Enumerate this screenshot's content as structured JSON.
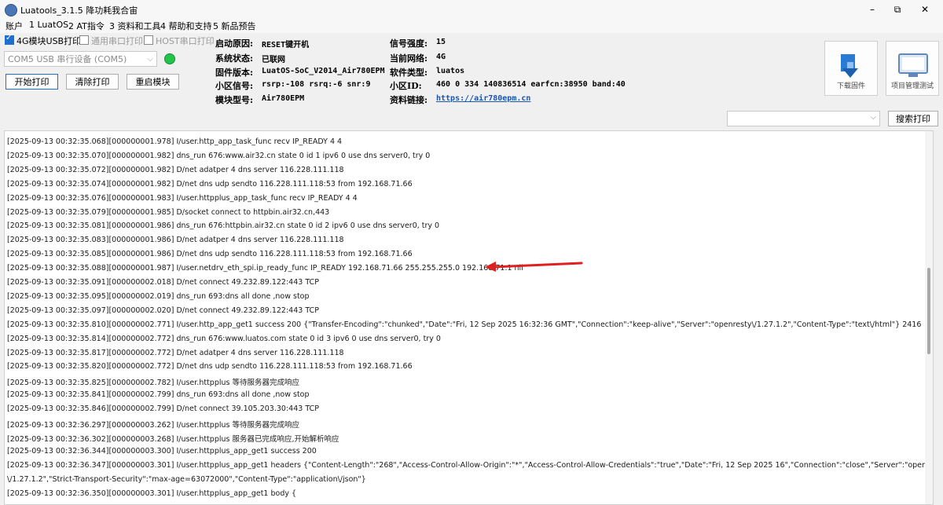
{
  "window": {
    "title": "Luatools_3.1.5 降功耗我合宙",
    "minimize": "–",
    "maximize": "⧉",
    "close": "✕"
  },
  "menu": [
    "账户",
    "1 LuatOS",
    "2 AT指令",
    "3 资料和工具",
    "4 帮助和支持",
    "5 新品预告"
  ],
  "options": {
    "usb_print": "4G模块USB打印",
    "serial_print": "通用串口打印",
    "host_print": "HOST串口打印"
  },
  "port": {
    "value": "COM5 USB 串行设备 (COM5)",
    "status_color": "#22c44a"
  },
  "buttons": {
    "start_print": "开始打印",
    "clear_print": "清除打印",
    "restart_module": "重启模块",
    "search_print": "搜索打印"
  },
  "info": {
    "boot_reason_label": "启动原因:",
    "boot_reason": "RESET键开机",
    "system_state_label": "系统状态:",
    "system_state": "已联网",
    "firmware_label": "固件版本:",
    "firmware": "LuatOS-SoC_V2014_Air780EPM",
    "cell_signal_label": "小区信号:",
    "cell_signal": "rsrp:-108 rsrq:-6 snr:9",
    "module_model_label": "模块型号:",
    "module_model": "Air780EPM",
    "signal_strength_label": "信号强度:",
    "signal_strength": "15",
    "network_label": "当前网络:",
    "network": "4G",
    "software_type_label": "软件类型:",
    "software_type": "luatos",
    "cell_id_label": "小区ID:",
    "cell_id": "460 0 334 140836514 earfcn:38950 band:40",
    "doc_link_label": "资料链接:",
    "doc_link": "https://air780epm.cn"
  },
  "tools": {
    "download_firmware": "下载固件",
    "project_management": "项目管理测试"
  },
  "log_lines": [
    "[2025-09-13 00:32:35.068][000000001.978] I/user.http_app_task_func recv IP_READY 4 4",
    "[2025-09-13 00:32:35.070][000000001.982] dns_run 676:www.air32.cn state 0 id 1 ipv6 0 use dns server0, try 0",
    "[2025-09-13 00:32:35.072][000000001.982] D/net adatper 4 dns server 116.228.111.118",
    "[2025-09-13 00:32:35.074][000000001.982] D/net dns udp sendto 116.228.111.118:53 from 192.168.71.66",
    "[2025-09-13 00:32:35.076][000000001.983] I/user.httpplus_app_task_func recv IP_READY 4 4",
    "[2025-09-13 00:32:35.079][000000001.985] D/socket connect to httpbin.air32.cn,443",
    "[2025-09-13 00:32:35.081][000000001.986] dns_run 676:httpbin.air32.cn state 0 id 2 ipv6 0 use dns server0, try 0",
    "[2025-09-13 00:32:35.083][000000001.986] D/net adatper 4 dns server 116.228.111.118",
    "[2025-09-13 00:32:35.085][000000001.986] D/net dns udp sendto 116.228.111.118:53 from 192.168.71.66",
    "[2025-09-13 00:32:35.088][000000001.987] I/user.netdrv_eth_spi.ip_ready_func IP_READY 192.168.71.66 255.255.255.0 192.168.71.1 nil",
    "[2025-09-13 00:32:35.091][000000002.018] D/net connect 49.232.89.122:443 TCP",
    "[2025-09-13 00:32:35.095][000000002.019] dns_run 693:dns all done ,now stop",
    "[2025-09-13 00:32:35.097][000000002.020] D/net connect 49.232.89.122:443 TCP",
    "[2025-09-13 00:32:35.810][000000002.771] I/user.http_app_get1 success 200 {\"Transfer-Encoding\":\"chunked\",\"Date\":\"Fri, 12 Sep 2025 16:32:36 GMT\",\"Connection\":\"keep-alive\",\"Server\":\"openresty\\/1.27.1.2\",\"Content-Type\":\"text\\/html\"} 2416",
    "[2025-09-13 00:32:35.814][000000002.772] dns_run 676:www.luatos.com state 0 id 3 ipv6 0 use dns server0, try 0",
    "[2025-09-13 00:32:35.817][000000002.772] D/net adatper 4 dns server 116.228.111.118",
    "[2025-09-13 00:32:35.820][000000002.772] D/net dns udp sendto 116.228.111.118:53 from 192.168.71.66",
    "[2025-09-13 00:32:35.825][000000002.782] I/user.httpplus 等待服务器完成响应",
    "[2025-09-13 00:32:35.841][000000002.799] dns_run 693:dns all done ,now stop",
    "[2025-09-13 00:32:35.846][000000002.799] D/net connect 39.105.203.30:443 TCP",
    "[2025-09-13 00:32:36.297][000000003.262] I/user.httpplus 等待服务器完成响应",
    "[2025-09-13 00:32:36.302][000000003.268] I/user.httpplus 服务器已完成响应,开始解析响应",
    "[2025-09-13 00:32:36.344][000000003.300] I/user.httpplus_app_get1 success 200",
    "[2025-09-13 00:32:36.347][000000003.301] I/user.httpplus_app_get1 headers {\"Content-Length\":\"268\",\"Access-Control-Allow-Origin\":\"*\",\"Access-Control-Allow-Credentials\":\"true\",\"Date\":\"Fri, 12 Sep 2025 16\",\"Connection\":\"close\",\"Server\":\"openresty",
    "\\/1.27.1.2\",\"Strict-Transport-Security\":\"max-age=63072000\",\"Content-Type\":\"application\\/json\"}",
    "[2025-09-13 00:32:36.350][000000003.301] I/user.httpplus_app_get1 body {"
  ],
  "colors": {
    "accent": "#1e6fd0",
    "annotation": "#e02020"
  }
}
